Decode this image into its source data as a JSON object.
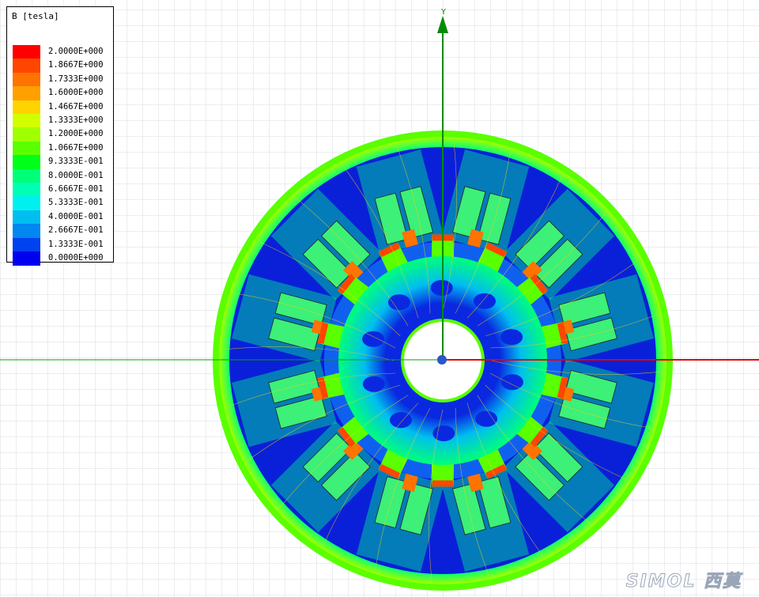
{
  "legend": {
    "title": "B [tesla]",
    "entries": [
      {
        "value": "2.0000E+000",
        "color": "#ff0000"
      },
      {
        "value": "1.8667E+000",
        "color": "#ff4600"
      },
      {
        "value": "1.7333E+000",
        "color": "#ff7300"
      },
      {
        "value": "1.6000E+000",
        "color": "#ffa000"
      },
      {
        "value": "1.4667E+000",
        "color": "#ffd200"
      },
      {
        "value": "1.3333E+000",
        "color": "#d2ff00"
      },
      {
        "value": "1.2000E+000",
        "color": "#a0ff00"
      },
      {
        "value": "1.0667E+000",
        "color": "#5aff00"
      },
      {
        "value": "9.3333E-001",
        "color": "#00ff19"
      },
      {
        "value": "8.0000E-001",
        "color": "#00ff78"
      },
      {
        "value": "6.6667E-001",
        "color": "#00ffb4"
      },
      {
        "value": "5.3333E-001",
        "color": "#00f0f0"
      },
      {
        "value": "4.0000E-001",
        "color": "#00bef0"
      },
      {
        "value": "2.6667E-001",
        "color": "#0087f0"
      },
      {
        "value": "1.3333E-001",
        "color": "#0041f0"
      },
      {
        "value": "0.0000E+000",
        "color": "#0000f0"
      }
    ]
  },
  "axes": {
    "y_label": "Y",
    "x_color": "#e00000",
    "y_color": "#008c00",
    "origin_color": "#2a55cc"
  },
  "watermark": "SIMOL 西莫",
  "colors": {
    "grid": "#d7dbe2",
    "field_low": "#0a20d8",
    "field_mid": "#00ff78",
    "field_high": "#ff0000"
  }
}
